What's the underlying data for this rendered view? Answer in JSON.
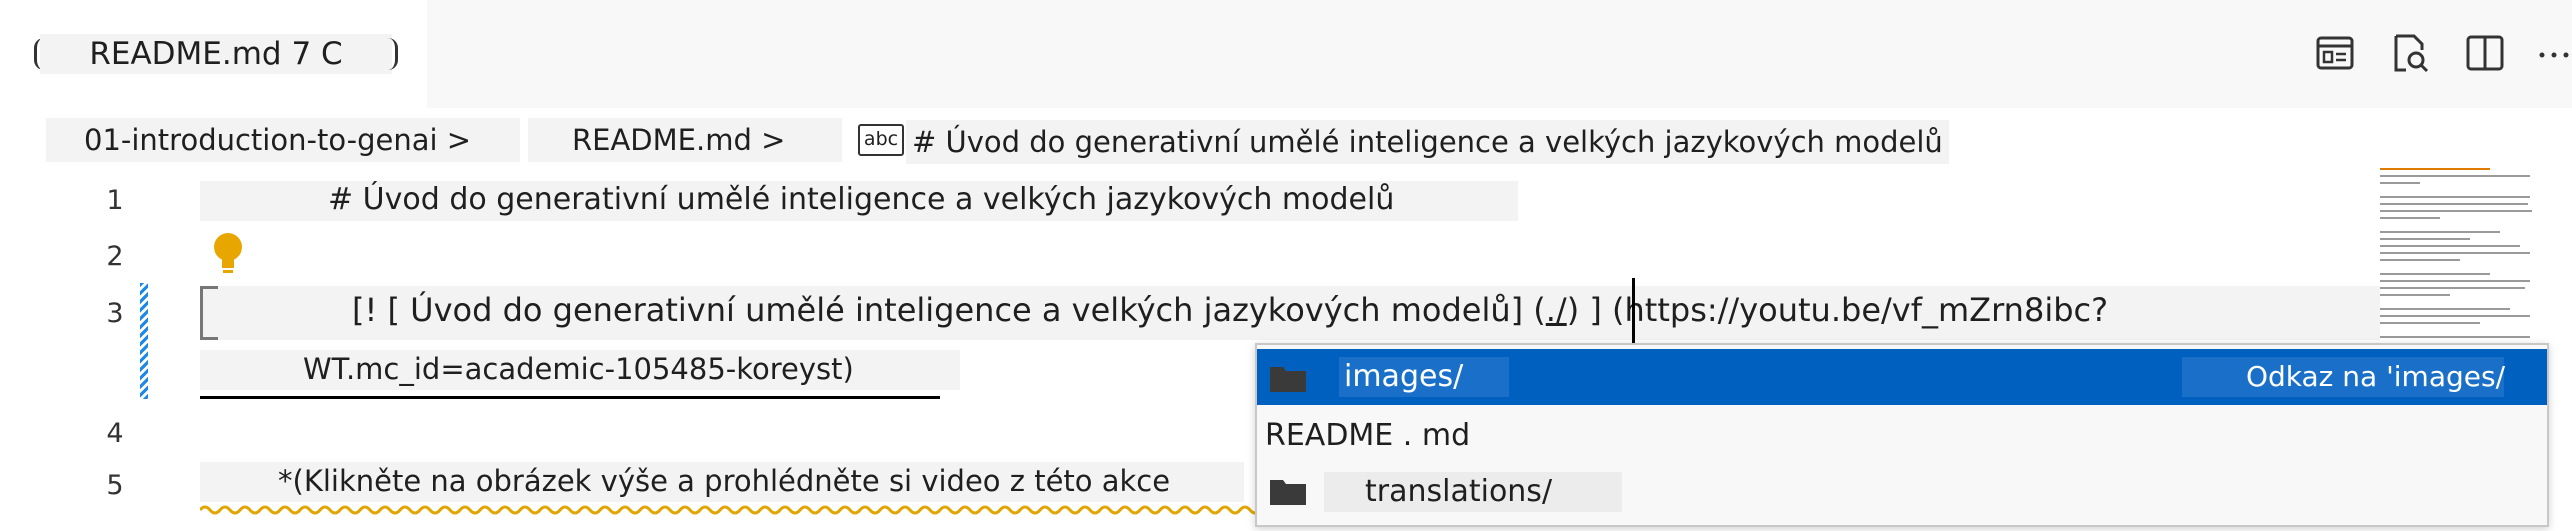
{
  "tab": {
    "title": "README.md 7 C"
  },
  "toolbar": {
    "icons": [
      "open-preview-icon",
      "preview-search-icon",
      "split-editor-icon",
      "more-actions-icon"
    ]
  },
  "breadcrumb": {
    "folder": "01-introduction-to-genai >",
    "file": "README.md >",
    "symbol_icon": "abc",
    "heading": "# Úvod do generativní umělé inteligence a velkých jazykových modelů"
  },
  "editor": {
    "line_numbers": [
      "1",
      "2",
      "3",
      "4",
      "5"
    ],
    "line1": "# Úvod do generativní umělé inteligence a velkých jazykových modelů",
    "line3_part1": "[! [ Úvod do generativní umělé inteligence a velkých jazykových modelů] (",
    "line3_link": "./",
    "line3_part2": ") ] (https://youtu.be/vf_mZrn8ibc?",
    "line3_wrap": "WT.mc_id=academic-105485-koreyst)",
    "line5": "*(Klikněte na obrázek výše a prohlédněte si video z této akce"
  },
  "suggestions": {
    "items": [
      {
        "label": "images/",
        "detail": "Odkaz na 'images/",
        "icon": "folder-icon",
        "selected": true
      },
      {
        "label": "README . md",
        "icon": "",
        "selected": false
      },
      {
        "label": "translations/",
        "icon": "folder-icon",
        "selected": false
      }
    ]
  },
  "colors": {
    "selection": "#0060c0",
    "lightbulb": "#e8a700",
    "squiggle": "#e2a400",
    "gutter_modified": "#1e88e5"
  }
}
